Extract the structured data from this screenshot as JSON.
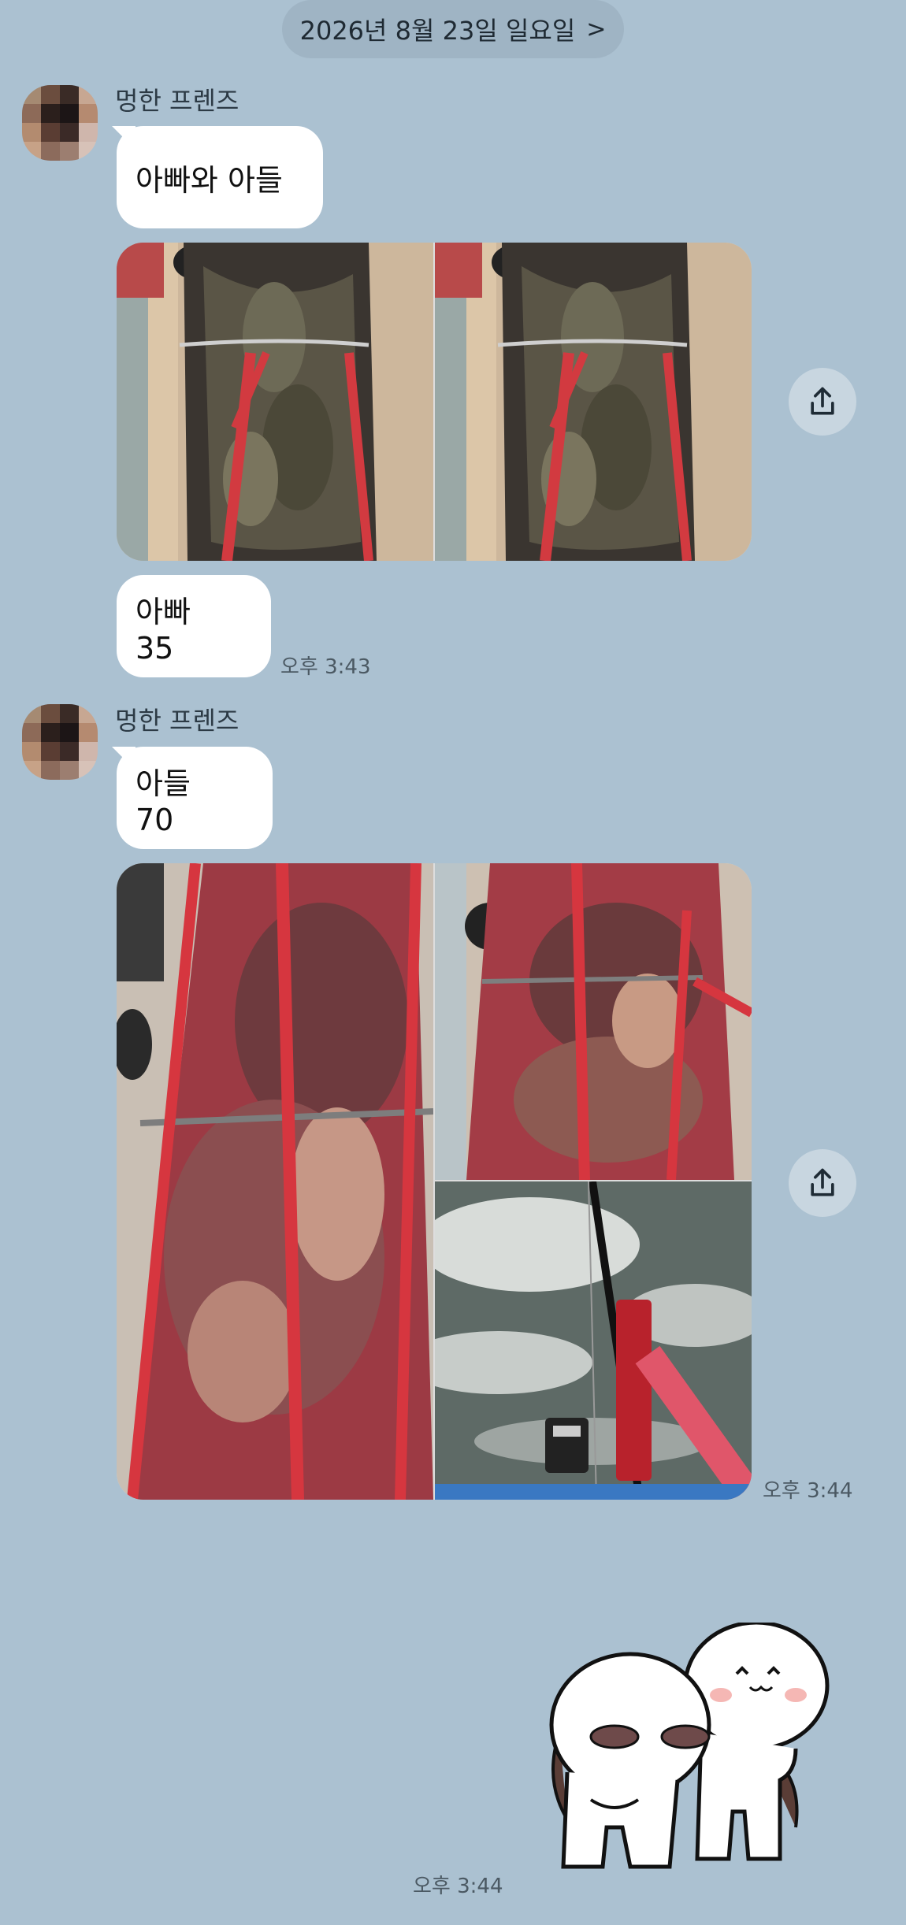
{
  "date_header": {
    "label": "2026년 8월 23일 일요일",
    "chevron": ">"
  },
  "messages": [
    {
      "sender": "멍한 프렌즈",
      "text": "아빠와 아들"
    },
    {
      "text": "아빠 35",
      "time": "오후 3:43"
    },
    {
      "sender": "멍한 프렌즈",
      "text": "아들 70"
    },
    {
      "time": "오후 3:44"
    },
    {
      "time": "오후 3:44"
    }
  ],
  "icons": {
    "share": "share-upload-icon",
    "next": "chevron-right-icon"
  },
  "colors": {
    "background": "#abc1d1",
    "bubble": "#ffffff",
    "net_red": "#c8373d"
  }
}
